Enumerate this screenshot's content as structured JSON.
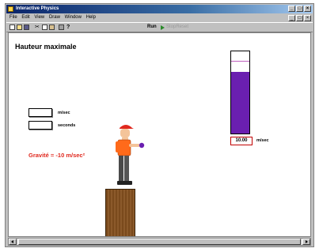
{
  "window": {
    "title": "Interactive Physics",
    "minimize": "_",
    "maximize": "□",
    "close": "×"
  },
  "menubar": {
    "items": [
      "File",
      "Edit",
      "View",
      "Draw",
      "Window",
      "Help"
    ],
    "child_minimize": "_",
    "child_restore": "□",
    "child_close": "×"
  },
  "toolbar": {
    "run_label": "Run",
    "ghost_label": "StopReset"
  },
  "workspace": {
    "title": "Hauteur maximale",
    "velocity_field": {
      "value": "",
      "unit": "m/sec"
    },
    "time_field": {
      "value": "",
      "unit": "seconds"
    },
    "gravity_text": "Gravité = -10 m/sec²",
    "meter": {
      "value": "10.00",
      "unit": "m/sec",
      "fill_fraction": 0.75,
      "fill_color": "#6a1fb0"
    }
  },
  "colors": {
    "accent_red": "#e0281e",
    "title_bar": "#0a246a"
  },
  "icons": [
    "new-icon",
    "open-icon",
    "save-icon",
    "cut-icon",
    "copy-icon",
    "paste-icon",
    "print-icon",
    "help-icon"
  ]
}
